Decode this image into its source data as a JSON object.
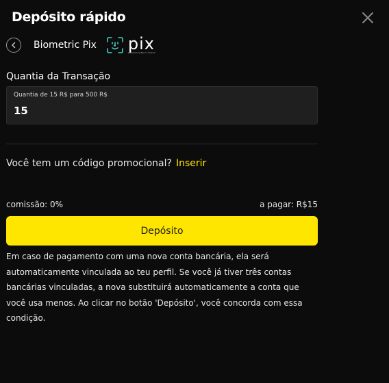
{
  "header": {
    "title": "Depósito rápido",
    "close_icon": "close-icon"
  },
  "method": {
    "back_icon": "chevron-left-icon",
    "label": "Biometric Pix",
    "logo_word": "pix",
    "logo_caption": "powered by Banco Central"
  },
  "amount": {
    "label": "Quantia da Transação",
    "hint": "Quantia de 15 R$ para 500 R$",
    "value": "15"
  },
  "promo": {
    "question": "Você tem um código promocional?",
    "link": "Inserir"
  },
  "summary": {
    "fee": "comissão: 0%",
    "to_pay": "a pagar: R$15"
  },
  "deposit_button": "Depósito",
  "notice": "Em caso de pagamento com uma nova conta bancária, ela será automaticamente vinculada ao teu perfil. Se você já tiver três contas bancárias vinculadas, a nova substituirá automaticamente a conta que você usa menos. Ao clicar no botão 'Depósito', você concorda com essa condição.",
  "colors": {
    "background": "#0c0c0c",
    "accent": "#ffe600",
    "input_bg": "#1f1f1f"
  }
}
